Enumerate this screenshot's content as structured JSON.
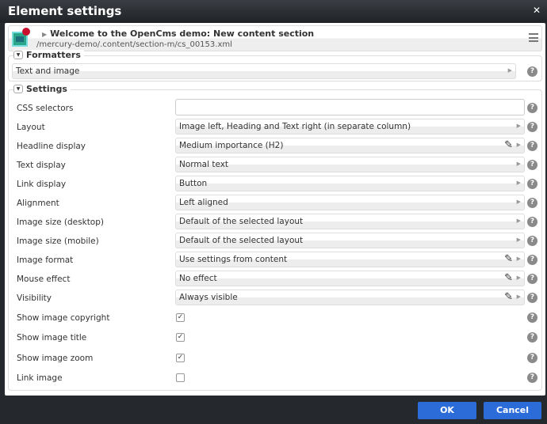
{
  "dialog": {
    "title": "Element settings",
    "close_icon": "close-icon"
  },
  "element": {
    "title": "Welcome to the OpenCms demo: New content section",
    "path": "/mercury-demo/.content/section-m/cs_00153.xml"
  },
  "formatters": {
    "legend": "Formatters",
    "value": "Text and image"
  },
  "settings": {
    "legend": "Settings",
    "rows": [
      {
        "label": "CSS selectors",
        "type": "text",
        "value": ""
      },
      {
        "label": "Layout",
        "type": "select",
        "value": "Image left, Heading and Text right (in separate column)",
        "pencil": false
      },
      {
        "label": "Headline display",
        "type": "select",
        "value": "Medium importance (H2)",
        "pencil": true
      },
      {
        "label": "Text display",
        "type": "select",
        "value": "Normal text",
        "pencil": false
      },
      {
        "label": "Link display",
        "type": "select",
        "value": "Button",
        "pencil": false
      },
      {
        "label": "Alignment",
        "type": "select",
        "value": "Left aligned",
        "pencil": false
      },
      {
        "label": "Image size (desktop)",
        "type": "select",
        "value": "Default of the selected layout",
        "pencil": false
      },
      {
        "label": "Image size (mobile)",
        "type": "select",
        "value": "Default of the selected layout",
        "pencil": false
      },
      {
        "label": "Image format",
        "type": "select",
        "value": "Use settings from content",
        "pencil": true
      },
      {
        "label": "Mouse effect",
        "type": "select",
        "value": "No effect",
        "pencil": true
      },
      {
        "label": "Visibility",
        "type": "select",
        "value": "Always visible",
        "pencil": true
      },
      {
        "label": "Show image copyright",
        "type": "checkbox",
        "checked": true
      },
      {
        "label": "Show image title",
        "type": "checkbox",
        "checked": true
      },
      {
        "label": "Show image zoom",
        "type": "checkbox",
        "checked": true
      },
      {
        "label": "Link image",
        "type": "checkbox",
        "checked": false
      }
    ]
  },
  "buttons": {
    "ok": "OK",
    "cancel": "Cancel"
  },
  "colors": {
    "primary_button": "#2c6cd8",
    "new_badge": "#c8102e"
  }
}
